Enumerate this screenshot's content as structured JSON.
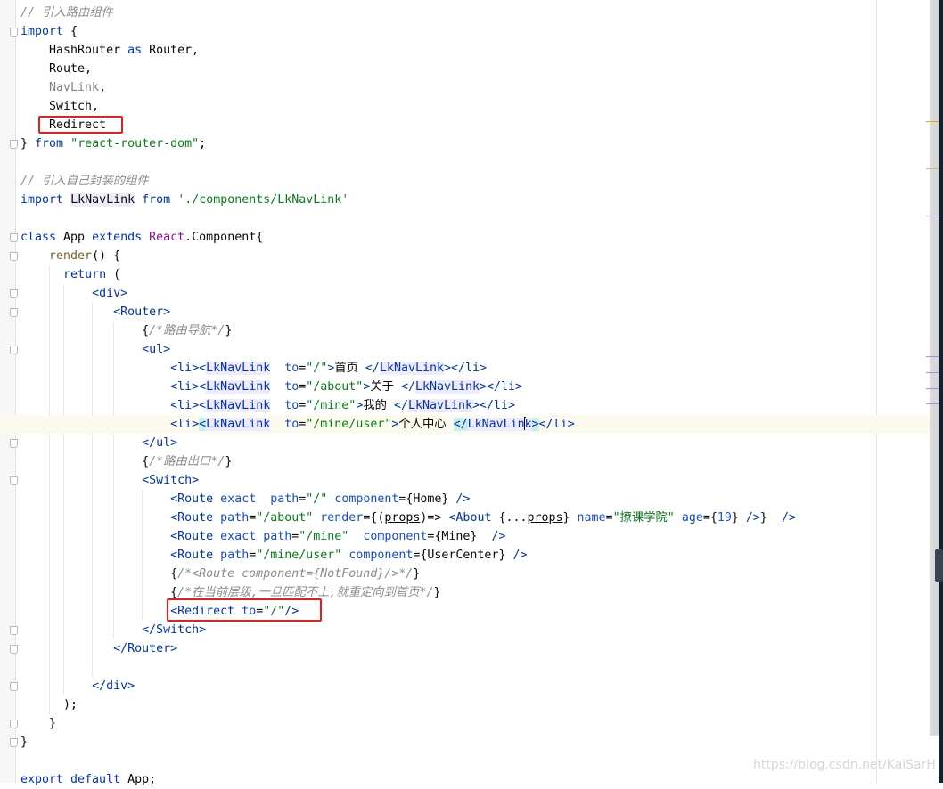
{
  "editor": {
    "current_line": 22,
    "lines": [
      [
        [
          "cmt",
          "// 引入路由组件"
        ]
      ],
      [
        [
          "kw",
          "import"
        ],
        [
          "",
          "{"
        ]
      ],
      [
        [
          "",
          "    HashRouter "
        ],
        [
          "kw",
          "as"
        ],
        [
          "",
          " Router,"
        ]
      ],
      [
        [
          "",
          "    Route,"
        ]
      ],
      [
        [
          "unused",
          "    NavLink"
        ],
        [
          "",
          ","
        ]
      ],
      [
        [
          "",
          "    Switch,"
        ]
      ],
      [
        [
          "",
          "    Redirect"
        ]
      ],
      [
        [
          "",
          "} "
        ],
        [
          "kw",
          "from"
        ],
        [
          "",
          " "
        ],
        [
          "str",
          "\"react-router-dom\""
        ],
        [
          "",
          ";"
        ]
      ],
      [],
      [
        [
          "cmt",
          "// 引入自己封装的组件"
        ]
      ],
      [
        [
          "kw",
          "import"
        ],
        [
          "",
          " "
        ],
        [
          "compplain",
          "LkNavLink"
        ],
        [
          "",
          " "
        ],
        [
          "kw",
          "from"
        ],
        [
          "",
          " "
        ],
        [
          "str",
          "'./components/LkNavLink'"
        ]
      ],
      [],
      [
        [
          "kw",
          "class"
        ],
        [
          "",
          " App "
        ],
        [
          "kw",
          "extends"
        ],
        [
          "",
          " "
        ],
        [
          "cls",
          "React"
        ],
        [
          "",
          ".Component{"
        ]
      ],
      [
        [
          "",
          "    "
        ],
        [
          "fn",
          "render"
        ],
        [
          "",
          "() {"
        ]
      ],
      [
        [
          "",
          "      "
        ],
        [
          "kw",
          "return"
        ],
        [
          "",
          " ("
        ]
      ],
      [
        [
          "",
          "          "
        ],
        [
          "tag",
          "<div>"
        ]
      ],
      [
        [
          "",
          "             "
        ],
        [
          "tag",
          "<Router>"
        ]
      ],
      [
        [
          "",
          "                 {"
        ],
        [
          "cmt",
          "/*路由导航*/"
        ],
        [
          "",
          "}"
        ]
      ],
      [
        [
          "",
          "                 "
        ],
        [
          "tag",
          "<ul>"
        ]
      ],
      [
        [
          "",
          "                     "
        ],
        [
          "tag",
          "<li><"
        ],
        [
          "comp",
          "LkNavLink"
        ],
        [
          "",
          "  "
        ],
        [
          "attr",
          "to"
        ],
        [
          "",
          "="
        ],
        [
          "str",
          "\"/\""
        ],
        [
          "tag",
          ">"
        ],
        [
          "",
          "首页 "
        ],
        [
          "tag",
          "</"
        ],
        [
          "comp",
          "LkNavLink"
        ],
        [
          "tag",
          "></li>"
        ]
      ],
      [
        [
          "",
          "                     "
        ],
        [
          "tag",
          "<li><"
        ],
        [
          "comp",
          "LkNavLink"
        ],
        [
          "",
          "  "
        ],
        [
          "attr",
          "to"
        ],
        [
          "",
          "="
        ],
        [
          "str",
          "\"/about\""
        ],
        [
          "tag",
          ">"
        ],
        [
          "",
          "关于 "
        ],
        [
          "tag",
          "</"
        ],
        [
          "comp",
          "LkNavLink"
        ],
        [
          "tag",
          "></li>"
        ]
      ],
      [
        [
          "",
          "                     "
        ],
        [
          "tag",
          "<li><"
        ],
        [
          "comp",
          "LkNavLink"
        ],
        [
          "",
          "  "
        ],
        [
          "attr",
          "to"
        ],
        [
          "",
          "="
        ],
        [
          "str",
          "\"/mine\""
        ],
        [
          "tag",
          ">"
        ],
        [
          "",
          "我的 "
        ],
        [
          "tag",
          "</"
        ],
        [
          "comp",
          "LkNavLink"
        ],
        [
          "tag",
          "></li>"
        ]
      ],
      [
        [
          "",
          "                     "
        ],
        [
          "tag",
          "<li>"
        ],
        [
          "match tag",
          "<"
        ],
        [
          "comp",
          "LkNavLink"
        ],
        [
          "",
          "  "
        ],
        [
          "attr",
          "to"
        ],
        [
          "",
          "="
        ],
        [
          "str",
          "\"/mine/user\""
        ],
        [
          "tag",
          ">"
        ],
        [
          "",
          "个人中心 "
        ],
        [
          "match tag",
          "</"
        ],
        [
          "comp",
          "LkNavLin"
        ],
        [
          "caret",
          ""
        ],
        [
          "comp",
          "k"
        ],
        [
          "match tag",
          ">"
        ],
        [
          "tag",
          "</li>"
        ]
      ],
      [
        [
          "",
          "                 "
        ],
        [
          "tag",
          "</ul>"
        ]
      ],
      [
        [
          "",
          "                 {"
        ],
        [
          "cmt",
          "/*路由出口*/"
        ],
        [
          "",
          "}"
        ]
      ],
      [
        [
          "",
          "                 "
        ],
        [
          "tag",
          "<Switch>"
        ]
      ],
      [
        [
          "",
          "                     "
        ],
        [
          "tag",
          "<Route "
        ],
        [
          "attr",
          "exact"
        ],
        [
          "",
          "  "
        ],
        [
          "attr",
          "path"
        ],
        [
          "",
          "="
        ],
        [
          "str",
          "\"/\""
        ],
        [
          "",
          " "
        ],
        [
          "attr",
          "component"
        ],
        [
          "",
          "={Home} "
        ],
        [
          "tag",
          "/>"
        ]
      ],
      [
        [
          "",
          "                     "
        ],
        [
          "tag",
          "<Route "
        ],
        [
          "attr",
          "path"
        ],
        [
          "",
          "="
        ],
        [
          "str",
          "\"/about\""
        ],
        [
          "",
          " "
        ],
        [
          "attr",
          "render"
        ],
        [
          "",
          "={("
        ],
        [
          "ul",
          "props"
        ],
        [
          "",
          ")=> "
        ],
        [
          "tag",
          "<About "
        ],
        [
          "",
          "{..."
        ],
        [
          "ul",
          "props"
        ],
        [
          "",
          "} "
        ],
        [
          "attr",
          "name"
        ],
        [
          "",
          "="
        ],
        [
          "str",
          "\"撩课学院\""
        ],
        [
          "",
          " "
        ],
        [
          "attr",
          "age"
        ],
        [
          "",
          "={"
        ],
        [
          "num",
          "19"
        ],
        [
          "",
          "} "
        ],
        [
          "tag",
          "/>"
        ],
        [
          "",
          "}  "
        ],
        [
          "tag",
          "/>"
        ]
      ],
      [
        [
          "",
          "                     "
        ],
        [
          "tag",
          "<Route "
        ],
        [
          "attr",
          "exact path"
        ],
        [
          "",
          "="
        ],
        [
          "str",
          "\"/mine\""
        ],
        [
          "",
          "  "
        ],
        [
          "attr",
          "component"
        ],
        [
          "",
          "={Mine}  "
        ],
        [
          "tag",
          "/>"
        ]
      ],
      [
        [
          "",
          "                     "
        ],
        [
          "tag",
          "<Route "
        ],
        [
          "attr",
          "path"
        ],
        [
          "",
          "="
        ],
        [
          "str",
          "\"/mine/user\""
        ],
        [
          "",
          " "
        ],
        [
          "attr",
          "component"
        ],
        [
          "",
          "={UserCenter} "
        ],
        [
          "tag",
          "/>"
        ]
      ],
      [
        [
          "",
          "                     {"
        ],
        [
          "cmt",
          "/*<Route component={NotFound}/>*/"
        ],
        [
          "",
          "}"
        ]
      ],
      [
        [
          "",
          "                     {"
        ],
        [
          "cmt",
          "/*在当前层级,一旦匹配不上,就重定向到首页*/"
        ],
        [
          "",
          "}"
        ]
      ],
      [
        [
          "",
          "                     "
        ],
        [
          "tag",
          "<Redirect "
        ],
        [
          "attr",
          "to"
        ],
        [
          "",
          "="
        ],
        [
          "str",
          "\"/\""
        ],
        [
          "tag",
          "/>"
        ]
      ],
      [
        [
          "",
          "                 "
        ],
        [
          "tag",
          "</Switch>"
        ]
      ],
      [
        [
          "",
          "             "
        ],
        [
          "tag",
          "</Router>"
        ]
      ],
      [],
      [
        [
          "",
          "          "
        ],
        [
          "tag",
          "</div>"
        ]
      ],
      [
        [
          "",
          "      );"
        ]
      ],
      [
        [
          "",
          "    }"
        ]
      ],
      [
        [
          "",
          "}"
        ]
      ],
      [],
      [
        [
          "kw",
          "export default"
        ],
        [
          "",
          " App;"
        ]
      ]
    ]
  },
  "watermark": "https://blog.csdn.net/KaiSarH",
  "colors": {
    "highlight_box": "#f01a1a",
    "keyword": "#0033b3",
    "string": "#067d17",
    "comment": "#8c8c8c"
  }
}
